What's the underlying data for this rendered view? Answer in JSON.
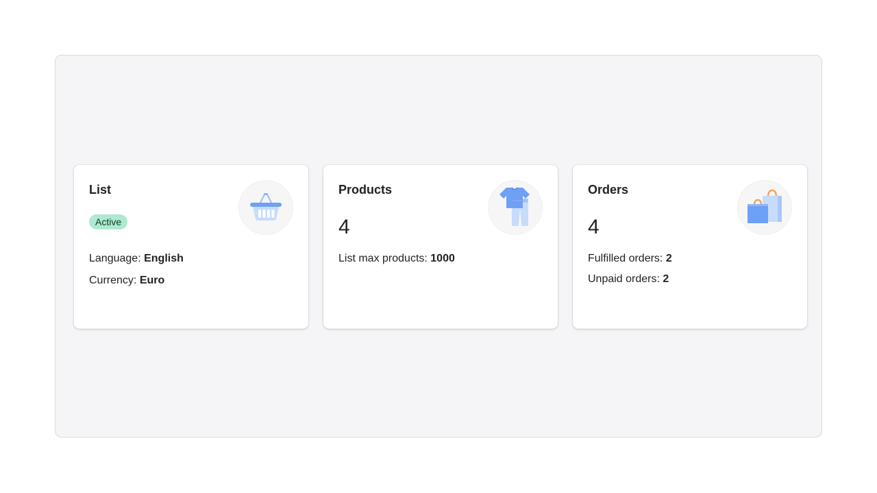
{
  "cards": {
    "list": {
      "title": "List",
      "status_badge": "Active",
      "language_label": "Language:",
      "language_value": "English",
      "currency_label": "Currency:",
      "currency_value": "Euro",
      "icon": "basket-icon"
    },
    "products": {
      "title": "Products",
      "count": "4",
      "max_label": "List max products:",
      "max_value": "1000",
      "icon": "clothing-icon"
    },
    "orders": {
      "title": "Orders",
      "count": "4",
      "fulfilled_label": "Fulfilled orders:",
      "fulfilled_value": "2",
      "unpaid_label": "Unpaid orders:",
      "unpaid_value": "2",
      "icon": "shopping-bags-icon"
    }
  },
  "colors": {
    "badge_bg": "#aee9d1",
    "icon_blue": "#6ea0f5",
    "icon_light_blue": "#c7dcfb",
    "bag_handle": "#f2a65a"
  }
}
